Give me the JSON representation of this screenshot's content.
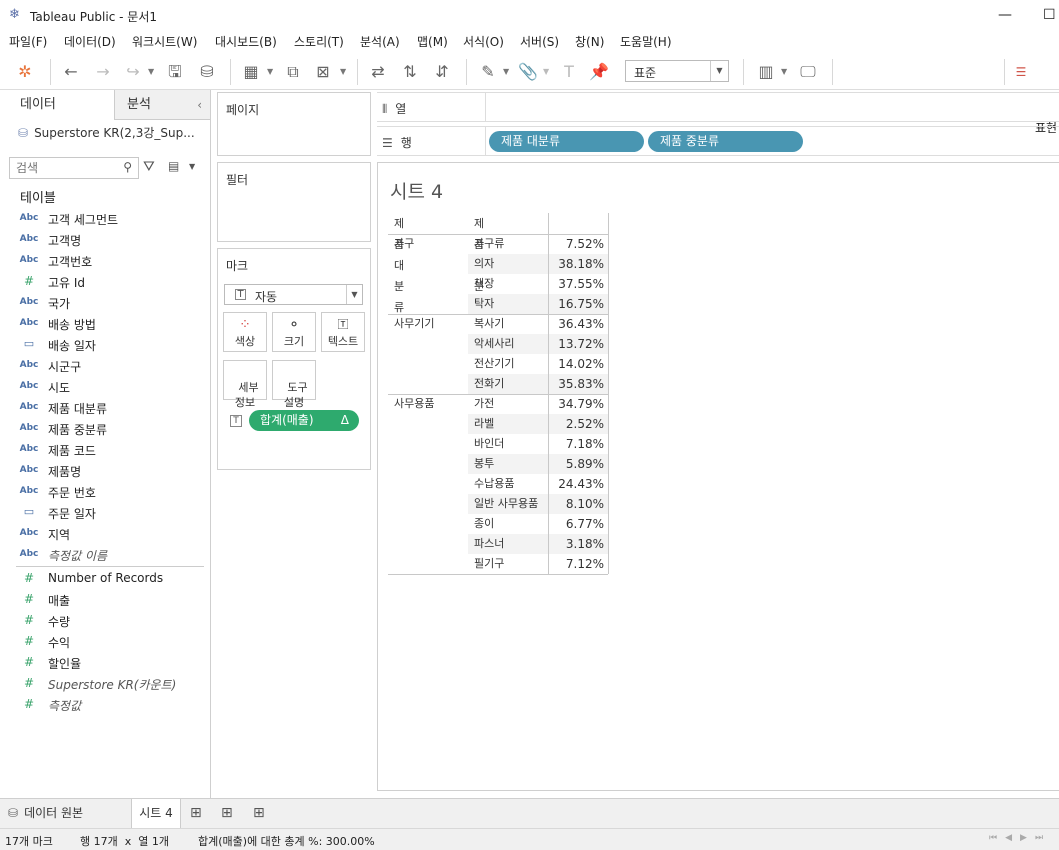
{
  "window": {
    "title": "Tableau Public - 문서1"
  },
  "menu": [
    "파일(F)",
    "데이터(D)",
    "워크시트(W)",
    "대시보드(B)",
    "스토리(T)",
    "분석(A)",
    "맵(M)",
    "서식(O)",
    "서버(S)",
    "창(N)",
    "도움말(H)"
  ],
  "toolbar": {
    "view_mode": "표준",
    "show_me_label": "표현"
  },
  "left_panel": {
    "tab_data": "데이터",
    "tab_analysis": "분석",
    "datasource": "Superstore KR(2,3강_Sup...",
    "search_placeholder": "검색",
    "tables_header": "테이블",
    "dimensions": [
      {
        "icon": "Abc",
        "label": "고객 세그먼트"
      },
      {
        "icon": "Abc",
        "label": "고객명"
      },
      {
        "icon": "Abc",
        "label": "고객번호"
      },
      {
        "icon": "#",
        "label": "고유 Id"
      },
      {
        "icon": "Abc",
        "label": "국가"
      },
      {
        "icon": "Abc",
        "label": "배송 방법"
      },
      {
        "icon": "date",
        "label": "배송 일자"
      },
      {
        "icon": "Abc",
        "label": "시군구"
      },
      {
        "icon": "Abc",
        "label": "시도"
      },
      {
        "icon": "Abc",
        "label": "제품 대분류"
      },
      {
        "icon": "Abc",
        "label": "제품 중분류"
      },
      {
        "icon": "Abc",
        "label": "제품 코드"
      },
      {
        "icon": "Abc",
        "label": "제품명"
      },
      {
        "icon": "Abc",
        "label": "주문 번호"
      },
      {
        "icon": "date",
        "label": "주문 일자"
      },
      {
        "icon": "Abc",
        "label": "지역"
      },
      {
        "icon": "Abc",
        "label": "측정값 이름",
        "italic": true
      }
    ],
    "measures": [
      {
        "icon": "#",
        "label": "Number of Records"
      },
      {
        "icon": "#",
        "label": "매출"
      },
      {
        "icon": "#",
        "label": "수량"
      },
      {
        "icon": "#",
        "label": "수익"
      },
      {
        "icon": "#",
        "label": "할인율"
      },
      {
        "icon": "#",
        "label": "Superstore KR(카운트)",
        "italic": true
      },
      {
        "icon": "#",
        "label": "측정값",
        "italic": true
      }
    ]
  },
  "cards": {
    "pages": "페이지",
    "filters": "필터",
    "marks": "마크",
    "mark_type": "자동",
    "mark_buttons": [
      "색상",
      "크기",
      "텍스트",
      "세부\n정보",
      "도구\n설명"
    ],
    "mark_pill": "합계(매출)",
    "mark_pill_delta": "Δ"
  },
  "shelves": {
    "columns_label": "열",
    "rows_label": "행",
    "row_pills": [
      "제품 대분류",
      "제품 중분류"
    ]
  },
  "sheet": {
    "title": "시트 4",
    "header_col1": "제품 대분류",
    "header_col2": "제품 중분류"
  },
  "chart_data": {
    "type": "table",
    "columns": [
      "제품 대분류",
      "제품 중분류",
      "합계(매출)"
    ],
    "groups": [
      {
        "category": "가구",
        "rows": [
          [
            "가구류",
            "7.52%"
          ],
          [
            "의자",
            "38.18%"
          ],
          [
            "책장",
            "37.55%"
          ],
          [
            "탁자",
            "16.75%"
          ]
        ]
      },
      {
        "category": "사무기기",
        "rows": [
          [
            "복사기",
            "36.43%"
          ],
          [
            "악세사리",
            "13.72%"
          ],
          [
            "전산기기",
            "14.02%"
          ],
          [
            "전화기",
            "35.83%"
          ]
        ]
      },
      {
        "category": "사무용품",
        "rows": [
          [
            "가전",
            "34.79%"
          ],
          [
            "라벨",
            "2.52%"
          ],
          [
            "바인더",
            "7.18%"
          ],
          [
            "봉투",
            "5.89%"
          ],
          [
            "수납용품",
            "24.43%"
          ],
          [
            "일반 사무용품",
            "8.10%"
          ],
          [
            "종이",
            "6.77%"
          ],
          [
            "파스너",
            "3.18%"
          ],
          [
            "필기구",
            "7.12%"
          ]
        ]
      }
    ]
  },
  "bottom_tabs": {
    "data_source": "데이터 원본",
    "sheet": "시트 4"
  },
  "status": {
    "marks": "17개 마크",
    "rows_cols": "행 17개  x  열 1개",
    "total": "합계(매출)에 대한 총계 %: 300.00%"
  },
  "colors": {
    "dimension_pill": "#4996b2",
    "measure_pill": "#2eaa6e"
  }
}
